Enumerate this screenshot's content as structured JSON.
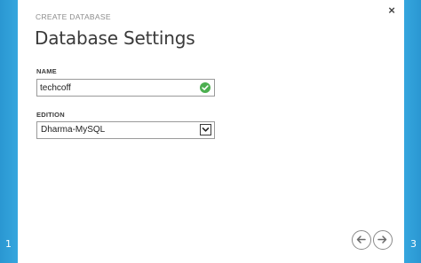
{
  "wizard": {
    "kicker": "CREATE DATABASE",
    "title": "Database Settings",
    "current_step": "1",
    "total_steps": "3",
    "close_label": "×"
  },
  "form": {
    "name": {
      "label": "NAME",
      "value": "techcoff",
      "status": "valid",
      "status_icon": "checkmark-circle-icon",
      "status_color": "#4caf50"
    },
    "edition": {
      "label": "EDITION",
      "selected": "Dharma-MySQL"
    }
  },
  "nav": {
    "back_icon": "arrow-left-icon",
    "next_icon": "arrow-right-icon"
  },
  "colors": {
    "accent": "#2e9fd8"
  }
}
